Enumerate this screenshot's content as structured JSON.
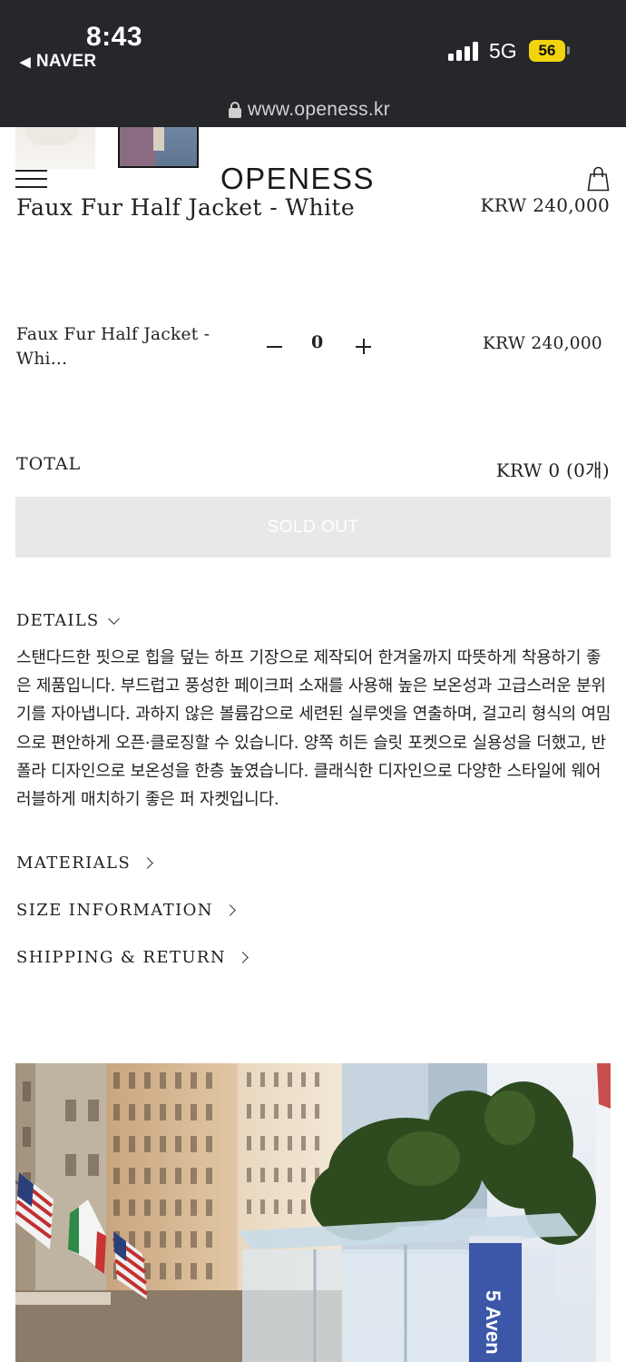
{
  "status_bar": {
    "time": "8:43",
    "back_app": "NAVER",
    "network": "5G",
    "battery": "56",
    "battery_color": "#f1d40c"
  },
  "browser": {
    "url": "www.openess.kr"
  },
  "header": {
    "logo": "OPENESS"
  },
  "product": {
    "title": "Faux Fur Half Jacket - White",
    "price": "KRW 240,000"
  },
  "option": {
    "name": "Faux Fur Half Jacket - Whi...",
    "quantity": "0",
    "price": "KRW 240,000"
  },
  "total": {
    "label": "TOTAL",
    "value": "KRW 0 (0개)"
  },
  "buy_button": {
    "label": "SOLD OUT",
    "bg_color": "#e7e8ea"
  },
  "details": {
    "heading": "DETAILS",
    "text": "스탠다드한 핏으로 힙을 덮는 하프 기장으로 제작되어 한겨울까지 따뜻하게 착용하기 좋은 제품입니다. 부드럽고 풍성한 페이크퍼 소재를 사용해 높은 보온성과 고급스러운 분위기를 자아냅니다. 과하지 않은 볼륨감으로 세련된 실루엣을 연출하며, 걸고리 형식의 여밈으로 편안하게 오픈·클로징할 수 있습니다. 양쪽 히든 슬릿 포켓으로 실용성을 더했고, 반폴라 디자인으로 보온성을 한층 높였습니다. 클래식한 디자인으로 다양한 스타일에 웨어러블하게 매치하기 좋은 퍼 자켓입니다."
  },
  "accordions": {
    "materials": "MATERIALS",
    "size": "SIZE INFORMATION",
    "shipping": "SHIPPING & RETURN"
  },
  "photo": {
    "sign_text": "5 Aven"
  }
}
